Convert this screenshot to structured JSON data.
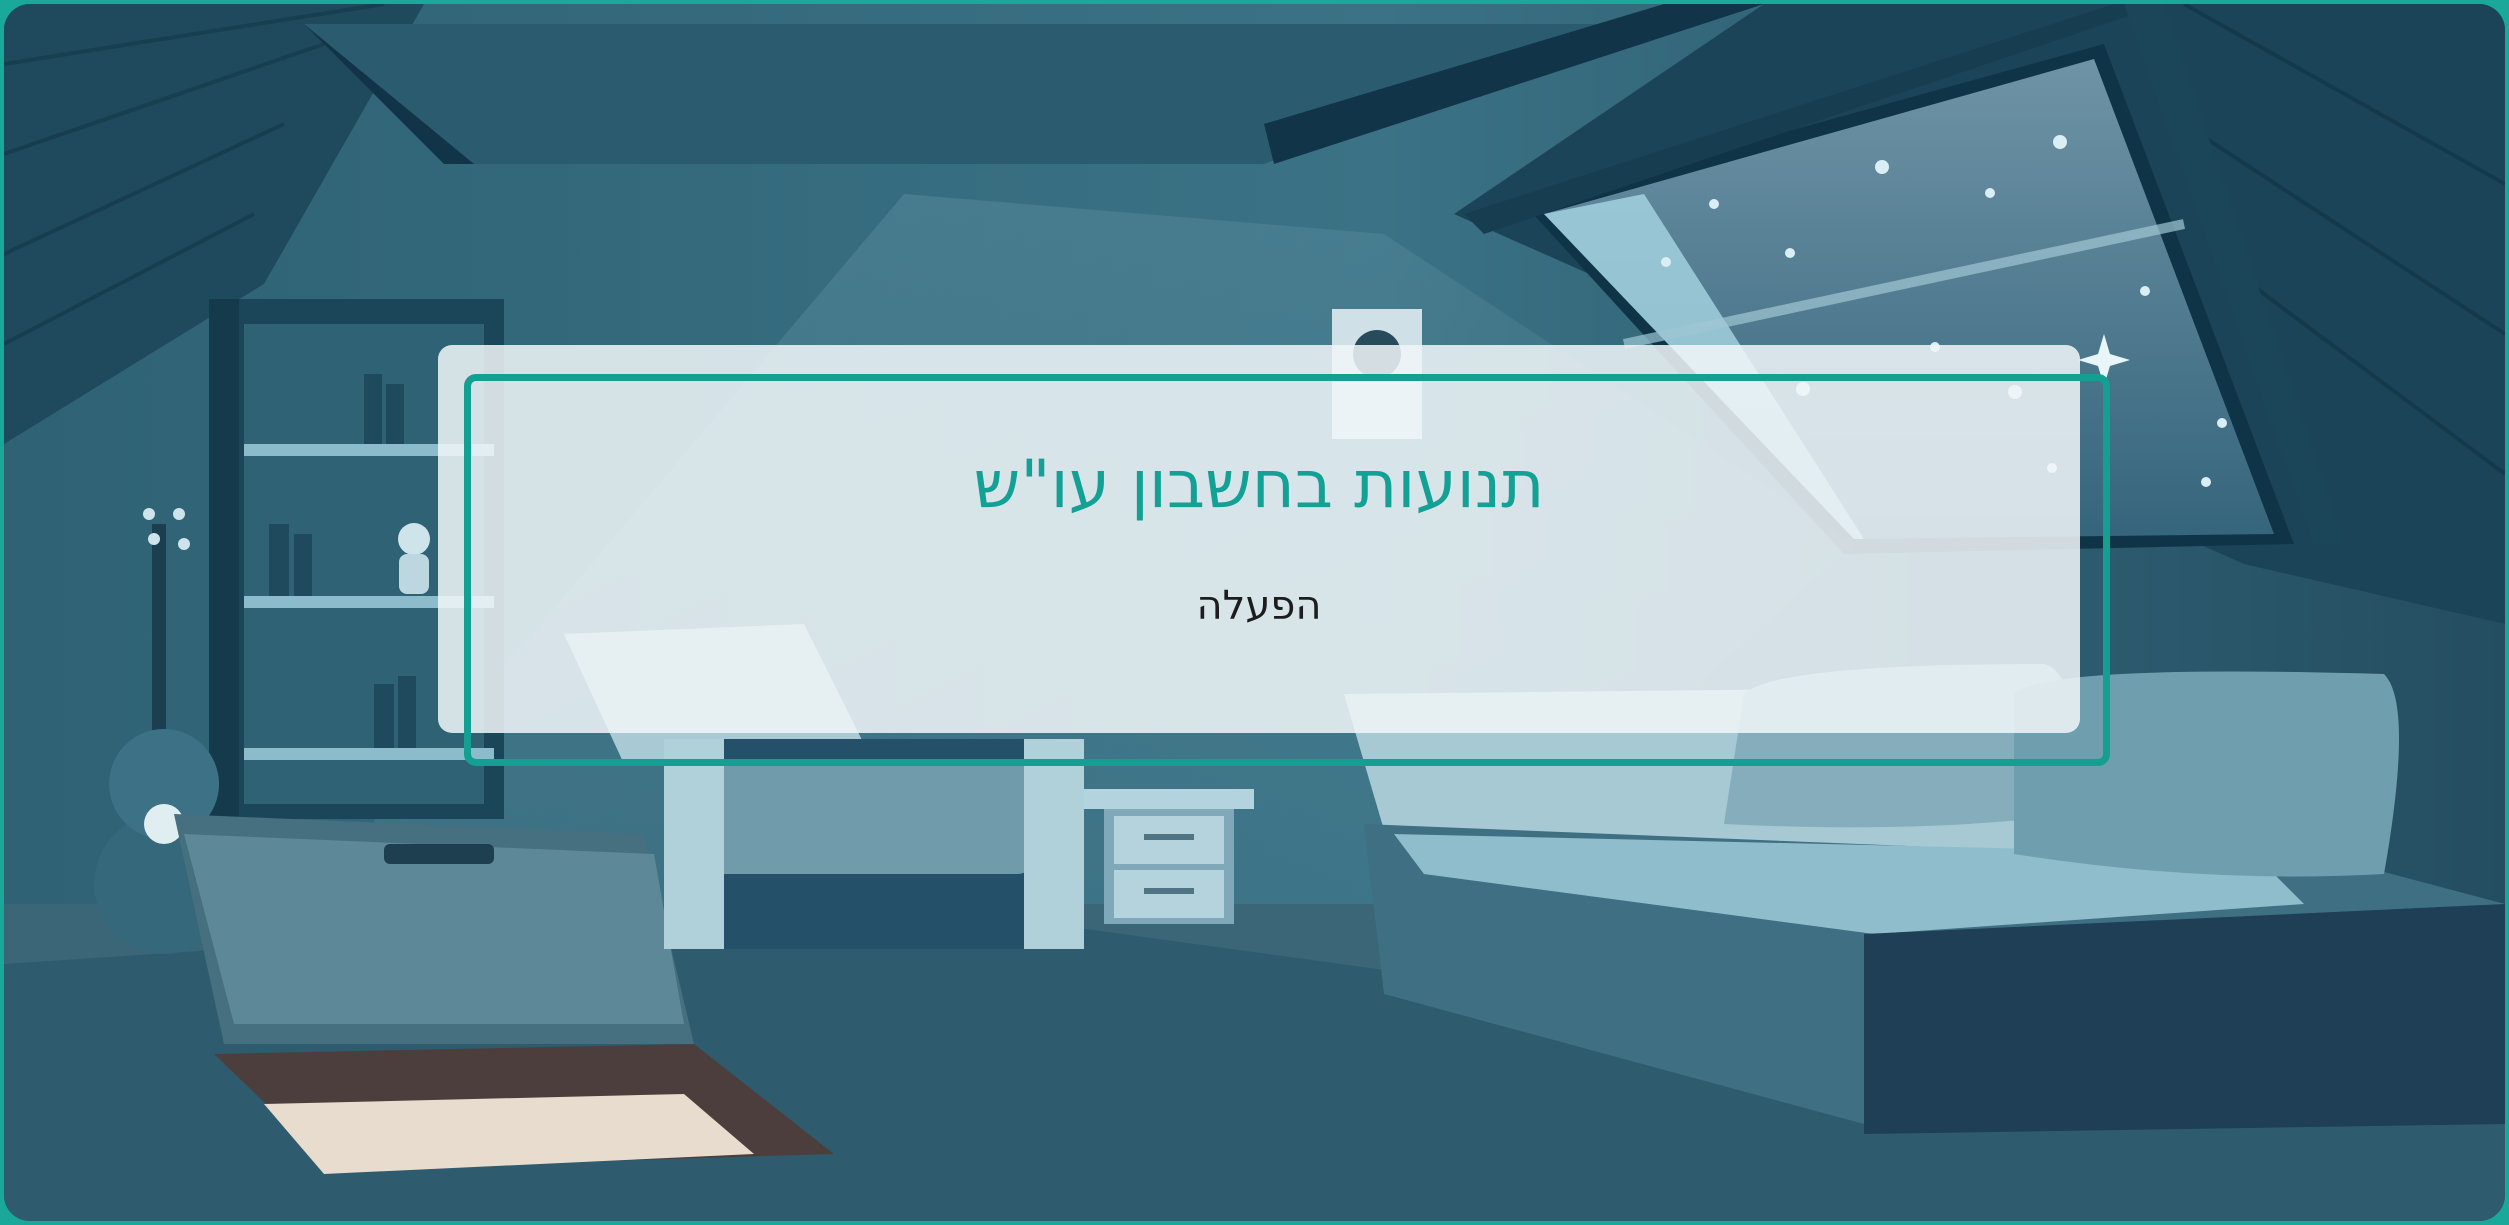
{
  "app": {
    "title": "תנועות בחשבון עו\"ש",
    "subtitle": "הפעלה"
  },
  "background": {
    "scene": "night attic bedroom illustration",
    "icons": [
      "guitar-icon",
      "bookshelf-icon",
      "armchair-icon",
      "nightstand-icon",
      "bed-icon",
      "skylight-window-icon",
      "speaker-icon",
      "astronaut-figure-icon",
      "chest-icon",
      "star-icon"
    ]
  },
  "colors": {
    "accent": "#14a195",
    "border": "#1aa89a",
    "panel": "#f0f6f8",
    "text": "#1d1d1d"
  }
}
